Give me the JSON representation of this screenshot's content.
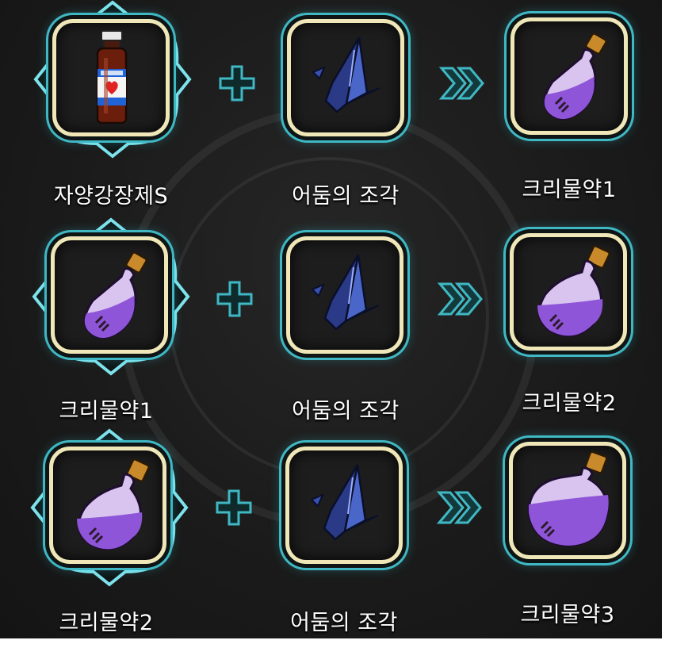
{
  "colors": {
    "frame_border": "#efe7b8",
    "glow": "#3fb8c4",
    "potion": "#8f55d8",
    "background": "#1b1b1b"
  },
  "recipes": [
    {
      "input": {
        "name": "자양강장제S",
        "icon": "tonic-bottle-icon"
      },
      "material": {
        "name": "어둠의 조각",
        "icon": "dark-shard-icon"
      },
      "result": {
        "name": "크리물약1",
        "icon": "small-potion-icon"
      }
    },
    {
      "input": {
        "name": "크리물약1",
        "icon": "small-potion-icon"
      },
      "material": {
        "name": "어둠의 조각",
        "icon": "dark-shard-icon"
      },
      "result": {
        "name": "크리물약2",
        "icon": "medium-potion-icon"
      }
    },
    {
      "input": {
        "name": "크리물약2",
        "icon": "medium-potion-icon"
      },
      "material": {
        "name": "어둠의 조각",
        "icon": "dark-shard-icon"
      },
      "result": {
        "name": "크리물약3",
        "icon": "large-potion-icon"
      }
    }
  ]
}
